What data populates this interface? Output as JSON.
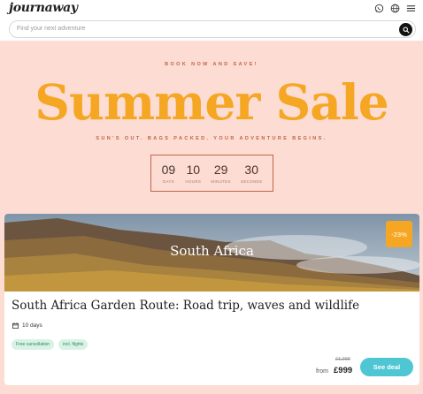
{
  "header": {
    "logo": "journaway",
    "icons": [
      "whatsapp-icon",
      "globe-icon",
      "menu-icon"
    ],
    "search_placeholder": "Find your next adventure"
  },
  "hero": {
    "eyebrow": "BOOK NOW AND SAVE!",
    "headline": "Summer Sale",
    "tagline": "SUN'S OUT. BAGS PACKED. YOUR ADVENTURE BEGINS.",
    "countdown": [
      {
        "value": "09",
        "label": "DAYS"
      },
      {
        "value": "10",
        "label": "HOURS"
      },
      {
        "value": "29",
        "label": "MINUTES"
      },
      {
        "value": "30",
        "label": "SECONDS"
      }
    ]
  },
  "card": {
    "destination": "South Africa",
    "discount": "-23%",
    "title": "South Africa Garden Route: Road trip, waves and wildlife",
    "duration": "10 days",
    "tags": [
      "Free cancellation",
      "incl. flights"
    ],
    "old_price": "£1,299",
    "from_label": "from",
    "price": "£999",
    "cta": "See deal"
  },
  "colors": {
    "background": "#fcdcd3",
    "accent": "#f5a623",
    "muted": "#c0664a",
    "cta": "#4ec6d4"
  }
}
